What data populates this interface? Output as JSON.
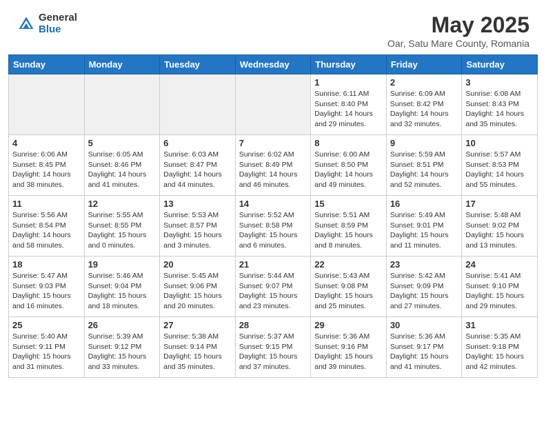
{
  "header": {
    "logo_general": "General",
    "logo_blue": "Blue",
    "month": "May 2025",
    "location": "Oar, Satu Mare County, Romania"
  },
  "weekdays": [
    "Sunday",
    "Monday",
    "Tuesday",
    "Wednesday",
    "Thursday",
    "Friday",
    "Saturday"
  ],
  "weeks": [
    [
      {
        "day": "",
        "info": "",
        "empty": true
      },
      {
        "day": "",
        "info": "",
        "empty": true
      },
      {
        "day": "",
        "info": "",
        "empty": true
      },
      {
        "day": "",
        "info": "",
        "empty": true
      },
      {
        "day": "1",
        "info": "Sunrise: 6:11 AM\nSunset: 8:40 PM\nDaylight: 14 hours\nand 29 minutes."
      },
      {
        "day": "2",
        "info": "Sunrise: 6:09 AM\nSunset: 8:42 PM\nDaylight: 14 hours\nand 32 minutes."
      },
      {
        "day": "3",
        "info": "Sunrise: 6:08 AM\nSunset: 8:43 PM\nDaylight: 14 hours\nand 35 minutes."
      }
    ],
    [
      {
        "day": "4",
        "info": "Sunrise: 6:06 AM\nSunset: 8:45 PM\nDaylight: 14 hours\nand 38 minutes."
      },
      {
        "day": "5",
        "info": "Sunrise: 6:05 AM\nSunset: 8:46 PM\nDaylight: 14 hours\nand 41 minutes."
      },
      {
        "day": "6",
        "info": "Sunrise: 6:03 AM\nSunset: 8:47 PM\nDaylight: 14 hours\nand 44 minutes."
      },
      {
        "day": "7",
        "info": "Sunrise: 6:02 AM\nSunset: 8:49 PM\nDaylight: 14 hours\nand 46 minutes."
      },
      {
        "day": "8",
        "info": "Sunrise: 6:00 AM\nSunset: 8:50 PM\nDaylight: 14 hours\nand 49 minutes."
      },
      {
        "day": "9",
        "info": "Sunrise: 5:59 AM\nSunset: 8:51 PM\nDaylight: 14 hours\nand 52 minutes."
      },
      {
        "day": "10",
        "info": "Sunrise: 5:57 AM\nSunset: 8:53 PM\nDaylight: 14 hours\nand 55 minutes."
      }
    ],
    [
      {
        "day": "11",
        "info": "Sunrise: 5:56 AM\nSunset: 8:54 PM\nDaylight: 14 hours\nand 58 minutes."
      },
      {
        "day": "12",
        "info": "Sunrise: 5:55 AM\nSunset: 8:55 PM\nDaylight: 15 hours\nand 0 minutes."
      },
      {
        "day": "13",
        "info": "Sunrise: 5:53 AM\nSunset: 8:57 PM\nDaylight: 15 hours\nand 3 minutes."
      },
      {
        "day": "14",
        "info": "Sunrise: 5:52 AM\nSunset: 8:58 PM\nDaylight: 15 hours\nand 6 minutes."
      },
      {
        "day": "15",
        "info": "Sunrise: 5:51 AM\nSunset: 8:59 PM\nDaylight: 15 hours\nand 8 minutes."
      },
      {
        "day": "16",
        "info": "Sunrise: 5:49 AM\nSunset: 9:01 PM\nDaylight: 15 hours\nand 11 minutes."
      },
      {
        "day": "17",
        "info": "Sunrise: 5:48 AM\nSunset: 9:02 PM\nDaylight: 15 hours\nand 13 minutes."
      }
    ],
    [
      {
        "day": "18",
        "info": "Sunrise: 5:47 AM\nSunset: 9:03 PM\nDaylight: 15 hours\nand 16 minutes."
      },
      {
        "day": "19",
        "info": "Sunrise: 5:46 AM\nSunset: 9:04 PM\nDaylight: 15 hours\nand 18 minutes."
      },
      {
        "day": "20",
        "info": "Sunrise: 5:45 AM\nSunset: 9:06 PM\nDaylight: 15 hours\nand 20 minutes."
      },
      {
        "day": "21",
        "info": "Sunrise: 5:44 AM\nSunset: 9:07 PM\nDaylight: 15 hours\nand 23 minutes."
      },
      {
        "day": "22",
        "info": "Sunrise: 5:43 AM\nSunset: 9:08 PM\nDaylight: 15 hours\nand 25 minutes."
      },
      {
        "day": "23",
        "info": "Sunrise: 5:42 AM\nSunset: 9:09 PM\nDaylight: 15 hours\nand 27 minutes."
      },
      {
        "day": "24",
        "info": "Sunrise: 5:41 AM\nSunset: 9:10 PM\nDaylight: 15 hours\nand 29 minutes."
      }
    ],
    [
      {
        "day": "25",
        "info": "Sunrise: 5:40 AM\nSunset: 9:11 PM\nDaylight: 15 hours\nand 31 minutes."
      },
      {
        "day": "26",
        "info": "Sunrise: 5:39 AM\nSunset: 9:12 PM\nDaylight: 15 hours\nand 33 minutes."
      },
      {
        "day": "27",
        "info": "Sunrise: 5:38 AM\nSunset: 9:14 PM\nDaylight: 15 hours\nand 35 minutes."
      },
      {
        "day": "28",
        "info": "Sunrise: 5:37 AM\nSunset: 9:15 PM\nDaylight: 15 hours\nand 37 minutes."
      },
      {
        "day": "29",
        "info": "Sunrise: 5:36 AM\nSunset: 9:16 PM\nDaylight: 15 hours\nand 39 minutes."
      },
      {
        "day": "30",
        "info": "Sunrise: 5:36 AM\nSunset: 9:17 PM\nDaylight: 15 hours\nand 41 minutes."
      },
      {
        "day": "31",
        "info": "Sunrise: 5:35 AM\nSunset: 9:18 PM\nDaylight: 15 hours\nand 42 minutes."
      }
    ]
  ]
}
